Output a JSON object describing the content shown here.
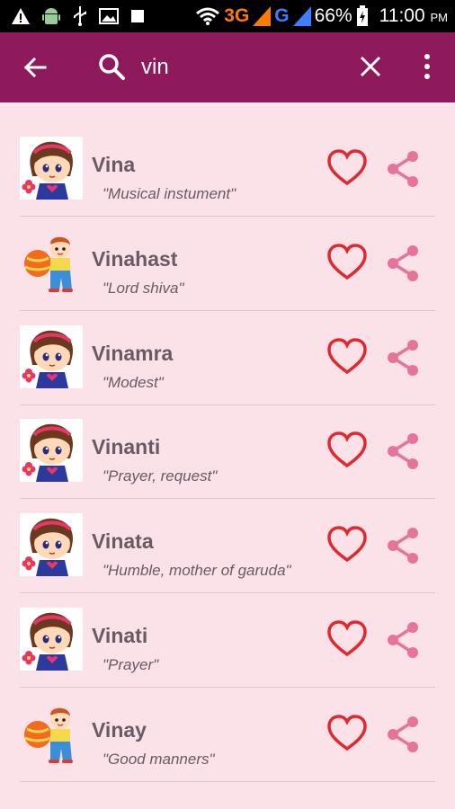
{
  "status_bar": {
    "network_3g": "3G",
    "network_g": "G",
    "battery": "66%",
    "time": "11:00",
    "ampm": "PM"
  },
  "toolbar": {
    "search_value": "vin",
    "back_icon": "back-arrow-icon",
    "search_icon": "search-icon",
    "clear_icon": "close-icon",
    "more_icon": "more-vert-icon"
  },
  "colors": {
    "toolbar": "#8e1a5c",
    "background": "#fbe1e8",
    "heart": "#e0282e",
    "share": "#e8739a",
    "text": "#6a5a63"
  },
  "names": [
    {
      "name": "Vina",
      "meaning": "\"Musical instument\"",
      "avatar": "girl"
    },
    {
      "name": "Vinahast",
      "meaning": "\"Lord shiva\"",
      "avatar": "boy"
    },
    {
      "name": "Vinamra",
      "meaning": "\"Modest\"",
      "avatar": "girl"
    },
    {
      "name": "Vinanti",
      "meaning": "\"Prayer, request\"",
      "avatar": "girl"
    },
    {
      "name": "Vinata",
      "meaning": "\"Humble, mother of garuda\"",
      "avatar": "girl"
    },
    {
      "name": "Vinati",
      "meaning": "\"Prayer\"",
      "avatar": "girl"
    },
    {
      "name": "Vinay",
      "meaning": "\"Good manners\"",
      "avatar": "boy"
    }
  ]
}
